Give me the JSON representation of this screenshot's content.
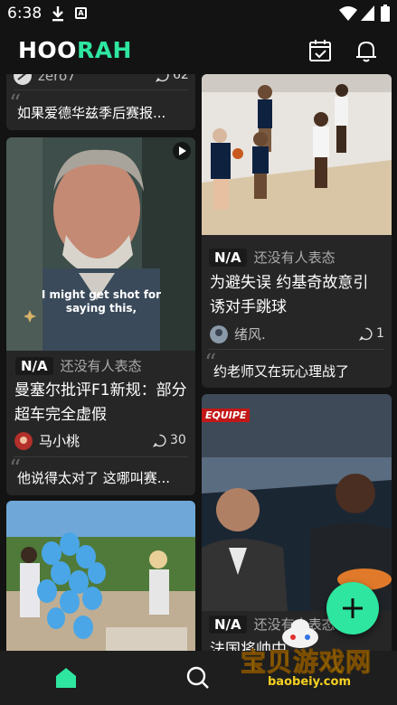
{
  "status_bar": {
    "time": "6:38",
    "icons": [
      "download-icon",
      "a-box-icon",
      "wifi-icon",
      "signal-icon",
      "battery-icon"
    ]
  },
  "header": {
    "logo_part1": "HOO",
    "logo_part2": "RAH",
    "icons": [
      "calendar-check-icon",
      "bell-icon"
    ]
  },
  "colors": {
    "accent": "#2ee6a0",
    "background": "#131313",
    "card": "#262626",
    "nav": "#1e1e1e"
  },
  "feed": {
    "left_column": [
      {
        "author": "zero7",
        "comment_count": "62",
        "quote": "如果爱德华兹季后赛报..."
      },
      {
        "video_caption": "I might get shot for saying this,",
        "rating": "N/A",
        "reaction_text": "还没有人表态",
        "title": "曼塞尔批评F1新规：部分超车完全虚假",
        "author": "马小桃",
        "comment_count": "30",
        "quote": "他说得太对了 这哪叫赛..."
      },
      {
        "image_desc": "balloons"
      }
    ],
    "right_column": [
      {
        "rating": "N/A",
        "reaction_text": "还没有人表态",
        "title": "为避失误 约基奇故意引诱对手跳球",
        "author": "绪风.",
        "comment_count": "1",
        "quote": "约老师又在玩心理战了"
      },
      {
        "image_brand": "EQUIPE",
        "rating": "N/A",
        "reaction_text": "还没有人表态",
        "title_partial": "法国将帅中..."
      }
    ]
  },
  "fab": {
    "icon": "plus-icon"
  },
  "bottom_nav": {
    "items": [
      "home-icon",
      "search-icon"
    ]
  },
  "watermark": {
    "main": "宝贝游戏网",
    "sub": "baobeiy.com"
  }
}
